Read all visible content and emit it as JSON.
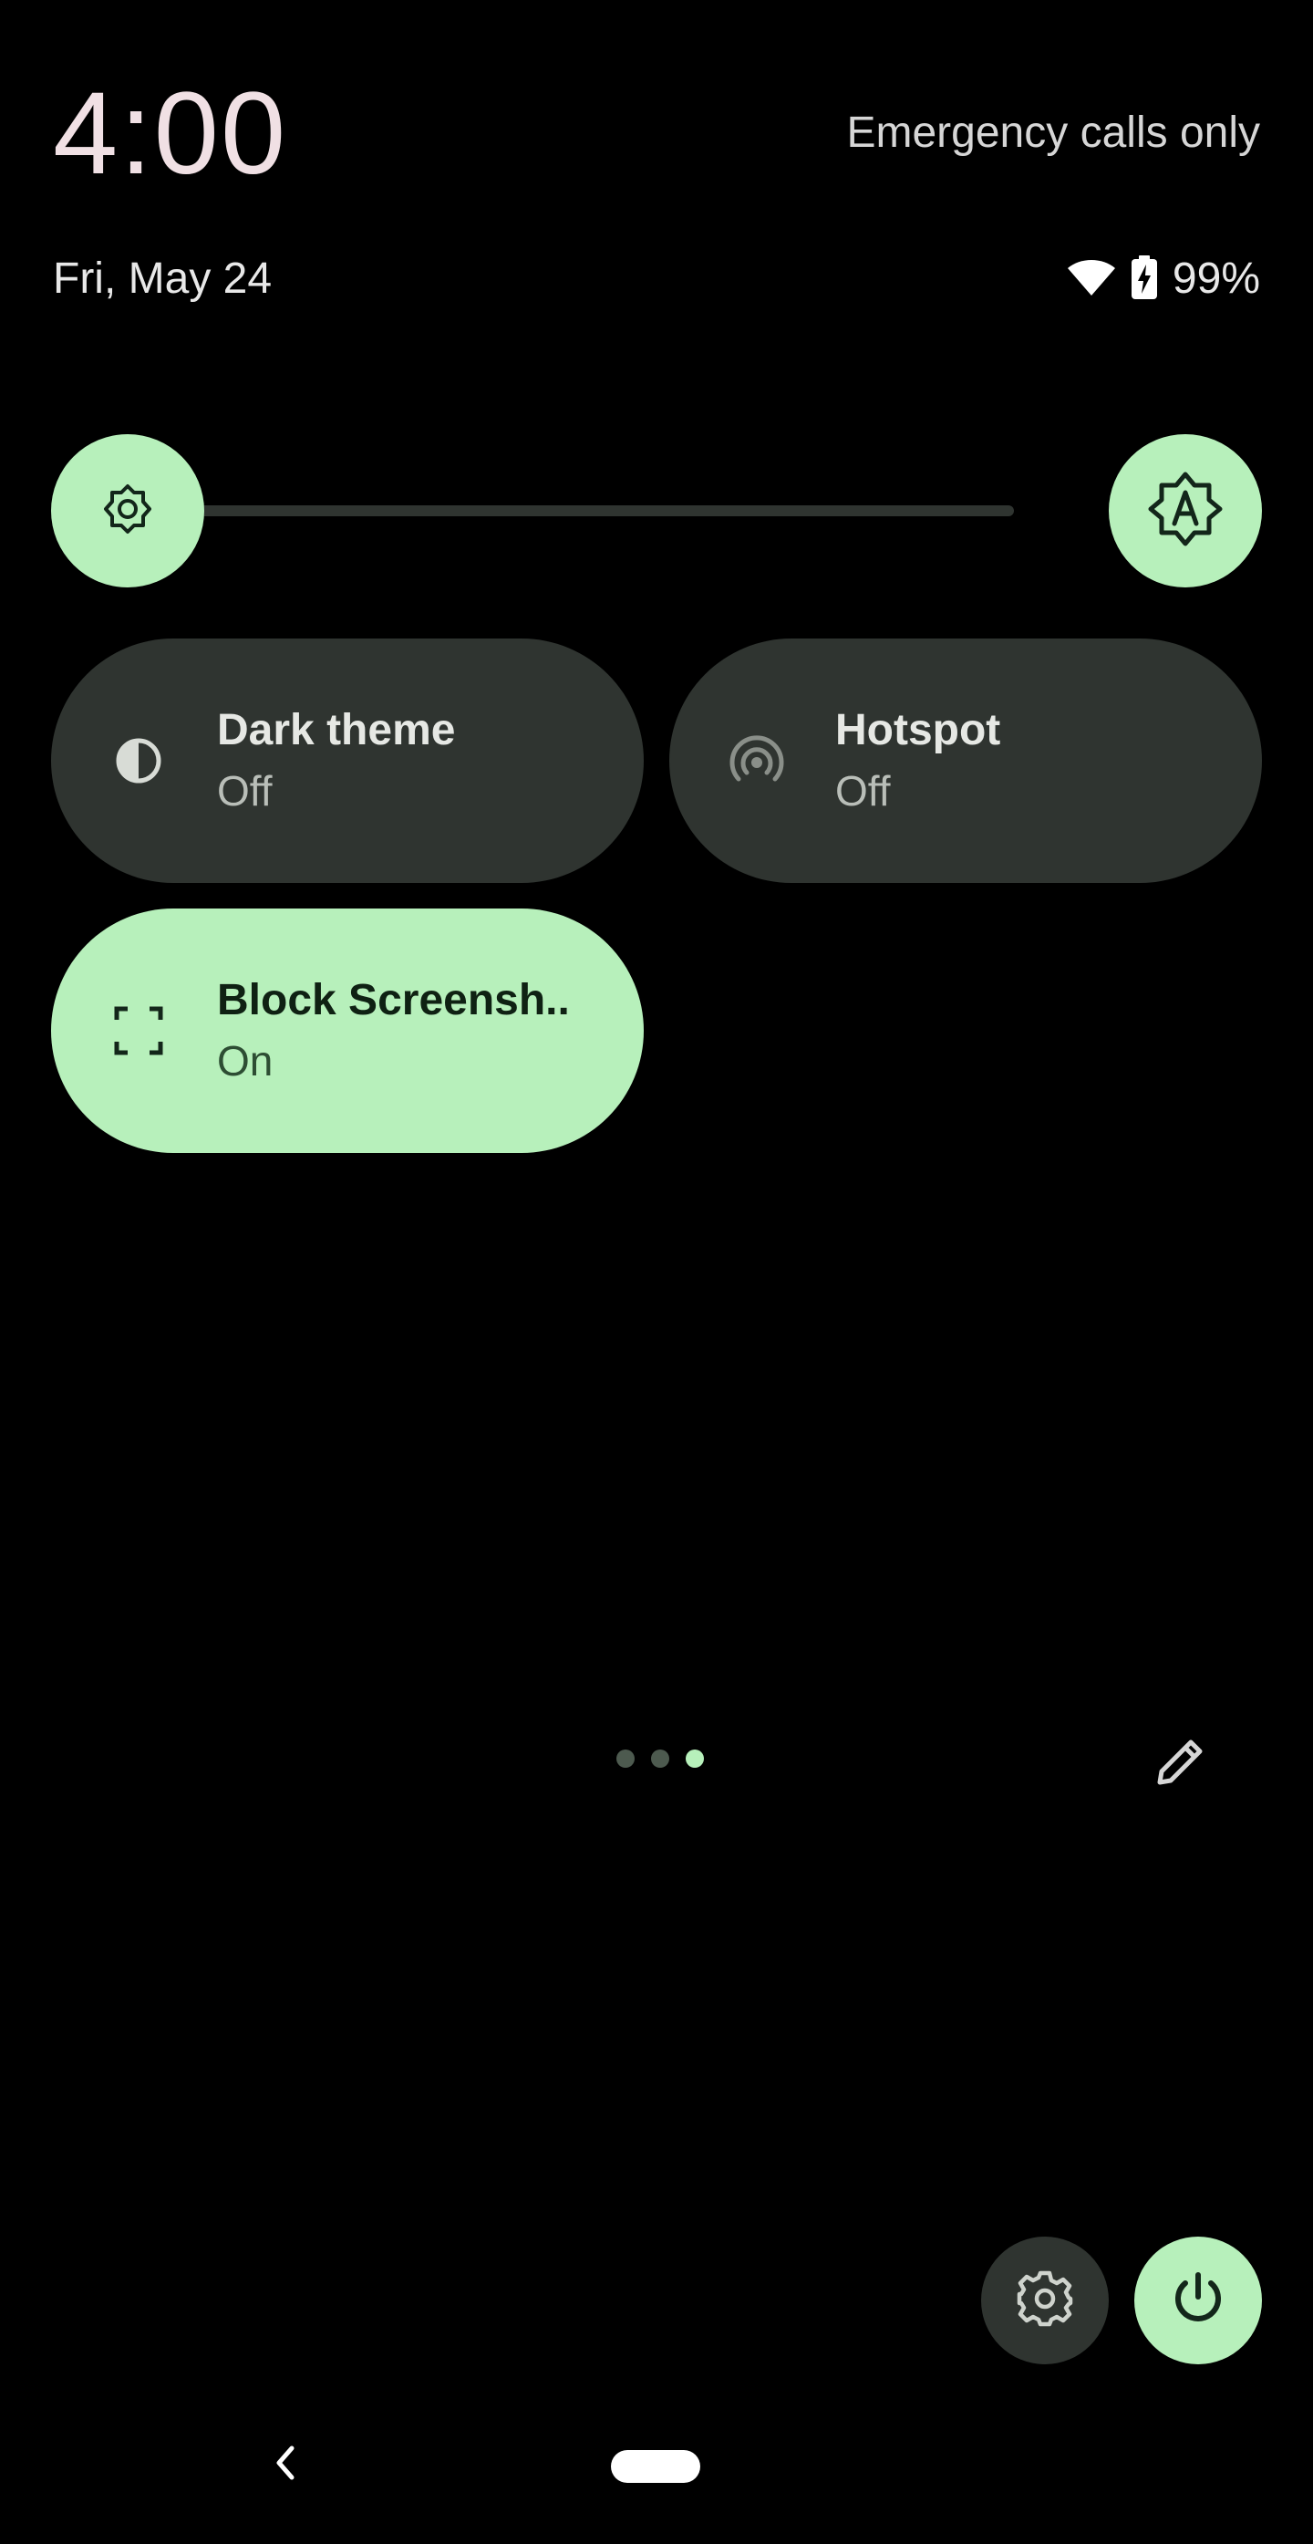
{
  "header": {
    "time": "4:00",
    "carrier_status": "Emergency calls only",
    "date": "Fri, May 24",
    "battery_percent": "99%"
  },
  "brightness": {
    "level": 0.0,
    "auto_icon": "auto-brightness-icon"
  },
  "tiles": [
    {
      "title": "Dark theme",
      "state": "Off",
      "icon": "dark-theme-icon",
      "active": false
    },
    {
      "title": "Hotspot",
      "state": "Off",
      "icon": "hotspot-icon",
      "active": false
    },
    {
      "title": "Block Screensh..",
      "state": "On",
      "icon": "screenshot-frame-icon",
      "active": true
    }
  ],
  "pager": {
    "pages": 3,
    "current": 3
  },
  "colors": {
    "accent": "#b7f0bb",
    "tile_off": "#2f3430",
    "background": "#000000",
    "clock": "#f0e0e4"
  },
  "icons": {
    "wifi": "wifi-icon",
    "battery": "battery-charging-icon",
    "edit": "pencil-icon",
    "settings": "gear-icon",
    "power": "power-icon",
    "back": "back-chevron-icon",
    "home": "home-pill"
  }
}
